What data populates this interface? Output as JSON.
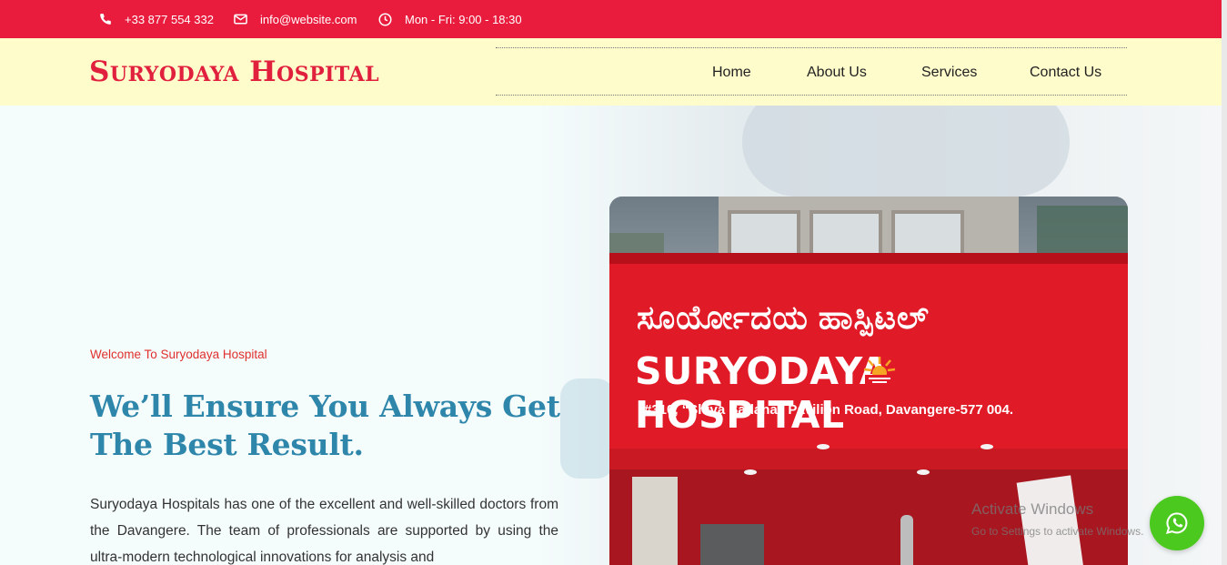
{
  "topbar": {
    "phone": "+33 877 554 332",
    "email": "info@website.com",
    "hours": "Mon - Fri: 9:00 - 18:30",
    "phone_icon": "phone-icon",
    "email_icon": "envelope-icon",
    "hours_icon": "clock-icon"
  },
  "header": {
    "logo": "Suryodaya Hospital",
    "nav": [
      "Home",
      "About Us",
      "Services",
      "Contact Us"
    ]
  },
  "hero": {
    "welcome": "Welcome To Suryodaya Hospital",
    "headline": "We’ll Ensure You Always Get The Best Result.",
    "paragraph": "Suryodaya Hospitals has one of the excellent and well-skilled doctors from the Davangere. The team of professionals are supported by using the ultra-modern technological innovations for analysis and"
  },
  "photo": {
    "sign_kannada": "ಸೂರ್ಯೋದಯ ಹಾಸ್ಪಿಟಲ್",
    "sign_english_left": "SURYODAYA",
    "sign_english_right": "HOSPITAL",
    "sign_address": "#310, “Shiva Sadana” Pavilion Road, Davangere-577 004."
  },
  "overlay": {
    "activate_title": "Activate Windows",
    "activate_sub": "Go to Settings to activate Windows."
  },
  "colors": {
    "brand_red": "#e91c3d",
    "header_bg": "#fffccc",
    "headline_blue": "#2e86ab",
    "whatsapp_green": "#4bc91e"
  },
  "floating": {
    "whatsapp_icon": "whatsapp-icon"
  }
}
